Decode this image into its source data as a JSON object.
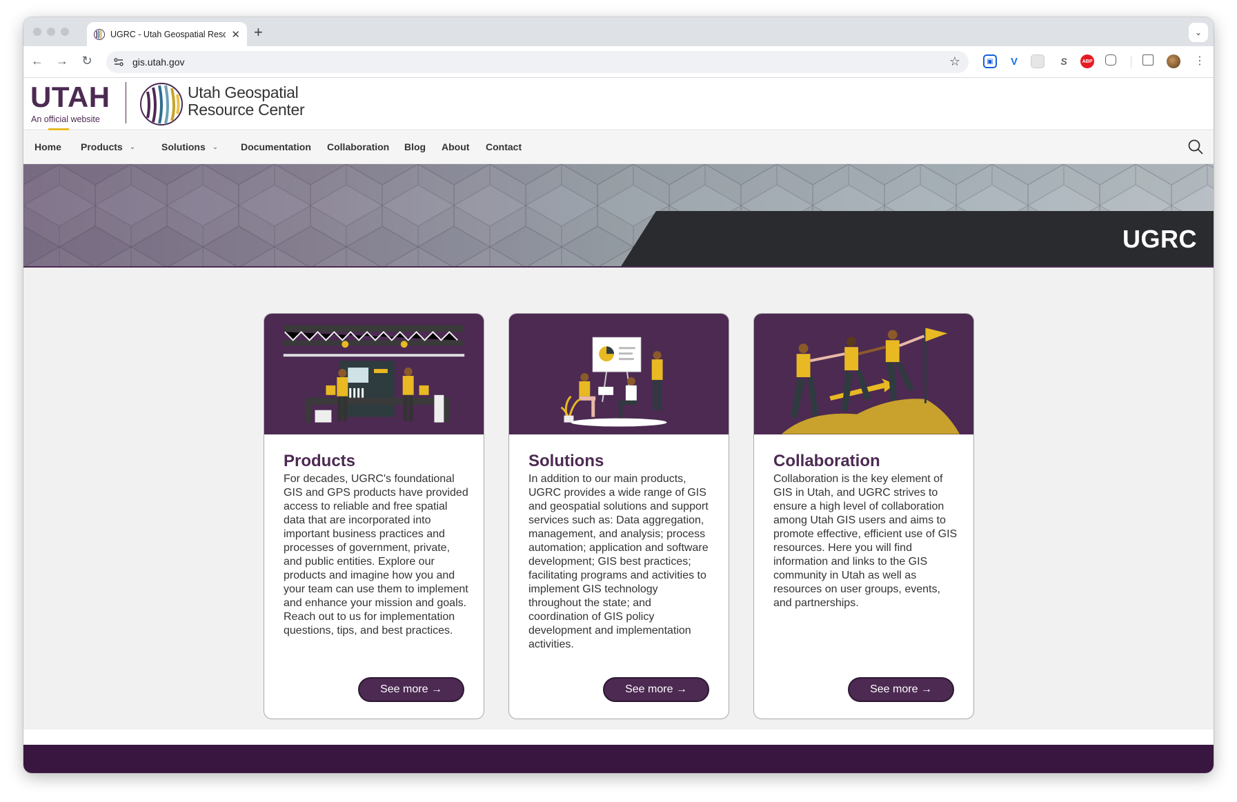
{
  "browser": {
    "tab_title": "UGRC - Utah Geospatial Resource Center",
    "tab_close": "✕",
    "new_tab": "+",
    "tab_menu": "⌄",
    "url": "gis.utah.gov",
    "back": "←",
    "forward": "→",
    "reload": "↻",
    "star": "☆",
    "menu": "⋮",
    "extensions": [
      {
        "name": "bitwarden-icon",
        "glyph": "⛉",
        "color": "#175ddc"
      },
      {
        "name": "v-extension-icon",
        "glyph": "V",
        "color": "#1a73e8"
      },
      {
        "name": "grey-extension-icon",
        "glyph": "",
        "color": "#d7d7d7"
      },
      {
        "name": "s-extension-icon",
        "glyph": "S",
        "color": "#ffffff"
      },
      {
        "name": "adblock-icon",
        "glyph": "ABP",
        "color": "#e51b24"
      },
      {
        "name": "puzzle-icon",
        "glyph": "",
        "color": "#ffffff"
      },
      {
        "name": "sidepanel-icon",
        "glyph": "",
        "color": "#ffffff"
      },
      {
        "name": "profile-avatar-icon",
        "glyph": "",
        "color": "#8b5a2b"
      }
    ]
  },
  "header": {
    "utah": "UTAH",
    "official": "An official website",
    "org_line1": "Utah Geospatial",
    "org_line2": "Resource Center",
    "accent": "#4c2a52",
    "gold": "#e8b923"
  },
  "nav": {
    "items": [
      {
        "label": "Home",
        "dropdown": false
      },
      {
        "label": "Products",
        "dropdown": true
      },
      {
        "label": "Solutions",
        "dropdown": true
      },
      {
        "label": "Documentation",
        "dropdown": false
      },
      {
        "label": "Collaboration",
        "dropdown": false
      },
      {
        "label": "Blog",
        "dropdown": false
      },
      {
        "label": "About",
        "dropdown": false
      },
      {
        "label": "Contact",
        "dropdown": false
      }
    ],
    "chevron": "⌄"
  },
  "hero": {
    "title": "UGRC"
  },
  "cards": [
    {
      "title": "Products",
      "text": "For decades, UGRC's foundational GIS and GPS products have provided access to reliable and free spatial data that are incorporated into important business practices and processes of government, private, and public entities. Explore our products and imagine how you and your team can use them to implement and enhance your mission and goals. Reach out to us for implementation questions, tips, and best practices.",
      "button": "See more →"
    },
    {
      "title": "Solutions",
      "text": "In addition to our main products, UGRC provides a wide range of GIS and geospatial solutions and support services such as: Data aggregation, management, and analysis; process automation; application and software development; GIS best practices; facilitating programs and activities to implement GIS technology throughout the state; and coordination of GIS policy development and implementation activities.",
      "button": "See more →"
    },
    {
      "title": "Collaboration",
      "text": "Collaboration is the key element of GIS in Utah, and UGRC strives to ensure a high level of collaboration among Utah GIS users and aims to promote effective, efficient use of GIS resources. Here you will find information and links to the GIS community in Utah as well as resources on user groups, events, and partnerships.",
      "button": "See more →"
    }
  ]
}
